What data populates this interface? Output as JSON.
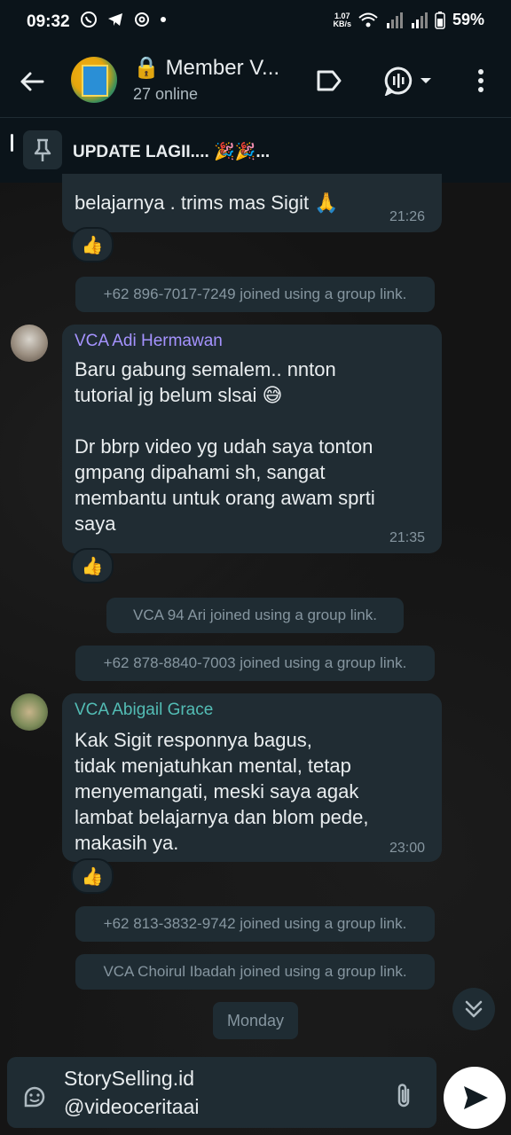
{
  "status_bar": {
    "time": "09:32",
    "net_speed": "1.07",
    "net_unit": "KB/s",
    "battery": "59%"
  },
  "header": {
    "title": "Member V...",
    "subtitle": "27 online",
    "lock_icon": "🔒"
  },
  "pinned": {
    "text": "UPDATE LAGII.... 🎉🎉..."
  },
  "messages": [
    {
      "text": "belajarnya . trims mas Sigit 🙏",
      "time": "21:26",
      "reaction": "👍"
    },
    {
      "sender": "VCA Adi Hermawan",
      "sender_color": "#a593ff",
      "text": "Baru gabung semalem.. nnton\ntutorial jg belum slsai 😅\n\nDr bbrp video yg udah saya tonton\ngmpang dipahami sh, sangat\nmembantu untuk orang awam sprti\nsaya",
      "time": "21:35",
      "reaction": "👍"
    },
    {
      "sender": "VCA Abigail Grace",
      "sender_color": "#53bdb5",
      "text": "Kak Sigit responnya bagus,\ntidak menjatuhkan mental, tetap\nmenyemangati, meski saya agak\nlambat belajarnya dan blom pede,\nmakasih ya.",
      "time": "23:00",
      "reaction": "👍"
    }
  ],
  "system": [
    "+62 896-7017-7249 joined using a group link.",
    "VCA 94 Ari joined using a group link.",
    "+62 878-8840-7003 joined using a group link.",
    "+62 813-3832-9742 joined using a group link.",
    "VCA Choirul Ibadah joined using a group link."
  ],
  "day_label": "Monday",
  "input": {
    "value": "StorySelling.id\n@videoceritaai"
  }
}
